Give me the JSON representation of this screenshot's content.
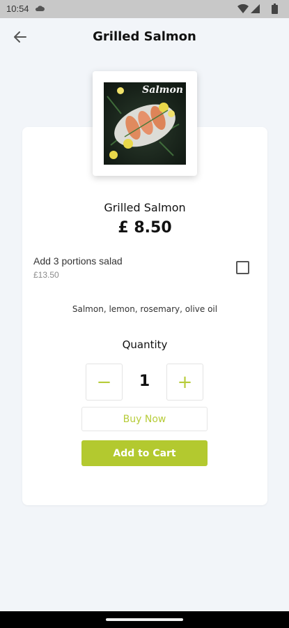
{
  "status_bar": {
    "time": "10:54"
  },
  "header": {
    "title": "Grilled Salmon"
  },
  "product": {
    "image_label": "Salmon",
    "name": "Grilled Salmon",
    "price": "£ 8.50",
    "ingredients": "Salmon, lemon, rosemary, olive oil"
  },
  "option": {
    "label": "Add 3 portions salad",
    "price": "£13.50",
    "checked": false
  },
  "quantity": {
    "label": "Quantity",
    "value": "1",
    "minus": "−",
    "plus": "+"
  },
  "actions": {
    "buy_now": "Buy Now",
    "add_to_cart": "Add to Cart"
  },
  "colors": {
    "accent": "#b3c92f",
    "background": "#f2f5f9"
  }
}
